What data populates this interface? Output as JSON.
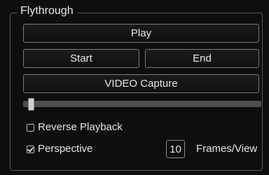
{
  "flythrough": {
    "title": "Flythrough",
    "play_label": "Play",
    "start_label": "Start",
    "end_label": "End",
    "video_capture_label": "VIDEO Capture",
    "slider_value": 0.02,
    "reverse_playback": {
      "label": "Reverse Playback",
      "checked": false
    },
    "perspective": {
      "label": "Perspective",
      "checked": true
    },
    "frames_per_view": {
      "value": "10",
      "label": "Frames/View"
    }
  }
}
